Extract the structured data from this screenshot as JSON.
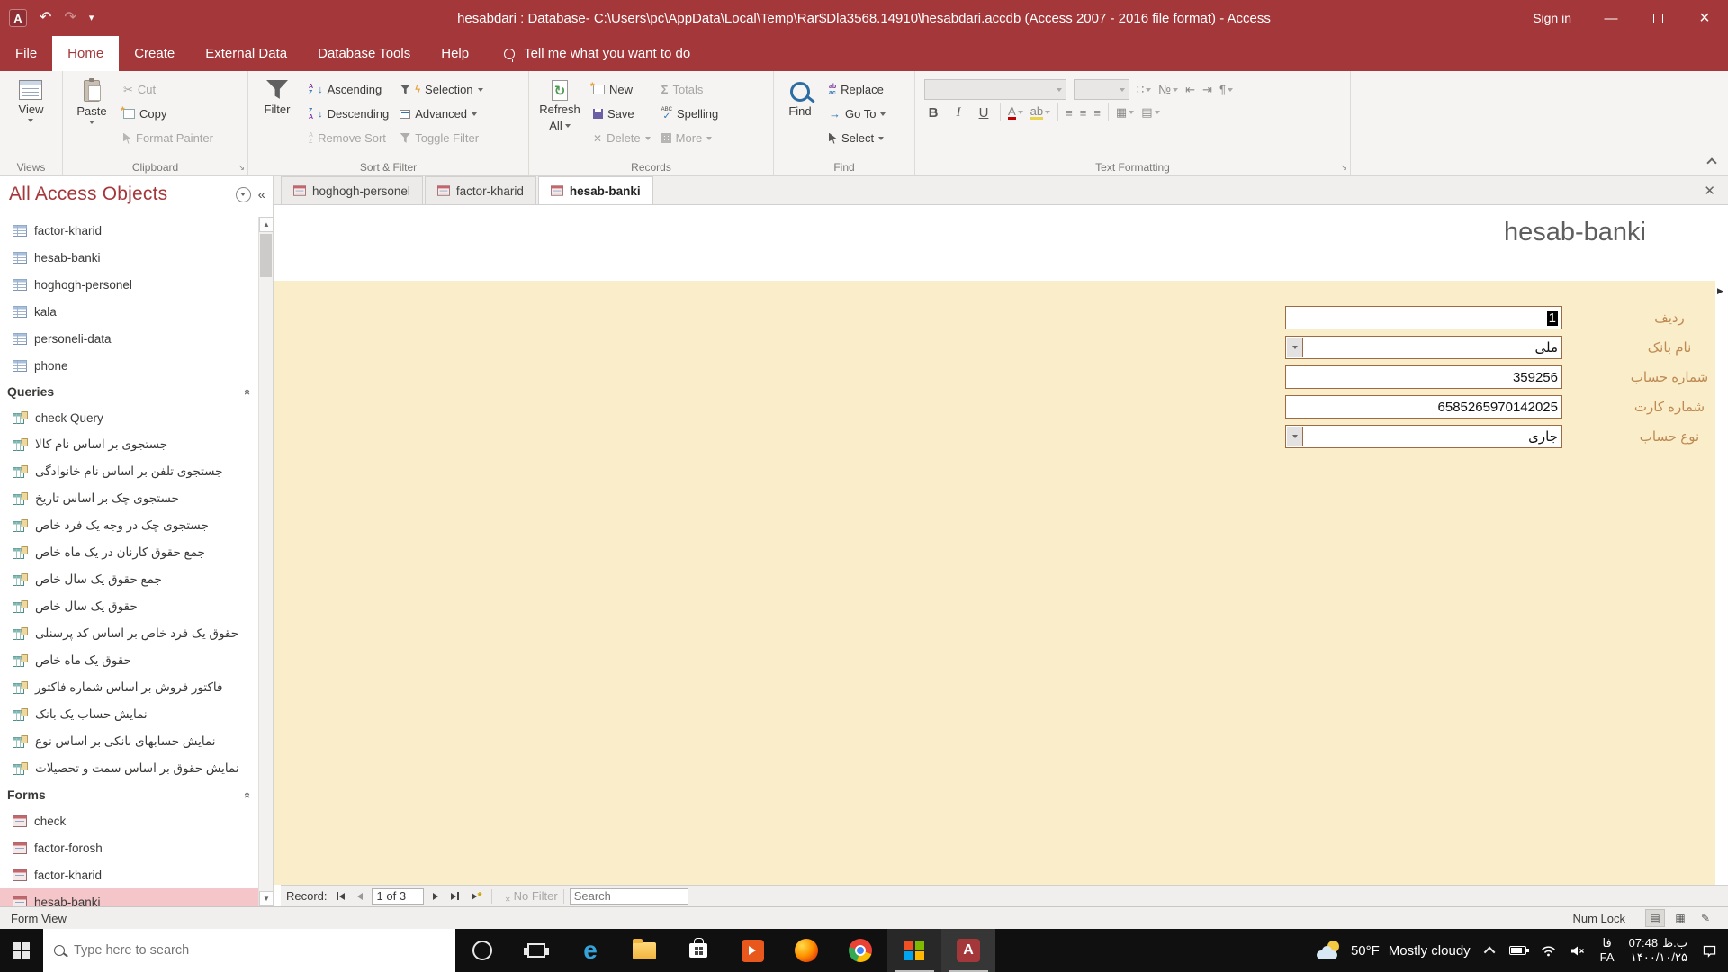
{
  "titlebar": {
    "app_initial": "A",
    "title": "hesabdari : Database- C:\\Users\\pc\\AppData\\Local\\Temp\\Rar$Dla3568.14910\\hesabdari.accdb (Access 2007 - 2016 file format)  -  Access",
    "sign_in": "Sign in"
  },
  "ribbon": {
    "tabs": [
      {
        "label": "File",
        "active": false
      },
      {
        "label": "Home",
        "active": true
      },
      {
        "label": "Create",
        "active": false
      },
      {
        "label": "External Data",
        "active": false
      },
      {
        "label": "Database Tools",
        "active": false
      },
      {
        "label": "Help",
        "active": false
      }
    ],
    "tell_me": "Tell me what you want to do",
    "views": {
      "group": "Views",
      "view": "View"
    },
    "clipboard": {
      "group": "Clipboard",
      "paste": "Paste",
      "cut": "Cut",
      "copy": "Copy",
      "format_painter": "Format Painter"
    },
    "sort_filter": {
      "group": "Sort & Filter",
      "filter": "Filter",
      "ascending": "Ascending",
      "descending": "Descending",
      "remove_sort": "Remove Sort",
      "selection": "Selection",
      "advanced": "Advanced",
      "toggle_filter": "Toggle Filter"
    },
    "records": {
      "group": "Records",
      "refresh_line1": "Refresh",
      "refresh_line2": "All",
      "new": "New",
      "save": "Save",
      "delete": "Delete",
      "totals": "Totals",
      "spelling": "Spelling",
      "more": "More"
    },
    "find": {
      "group": "Find",
      "find": "Find",
      "replace": "Replace",
      "goto": "Go To",
      "select": "Select"
    },
    "text_formatting": {
      "group": "Text Formatting",
      "bold": "B",
      "italic": "I",
      "underline": "U",
      "font_color": "A",
      "highlight": "ab"
    }
  },
  "nav": {
    "header": "All Access Objects",
    "tables": [
      {
        "label": "factor-kharid"
      },
      {
        "label": "hesab-banki"
      },
      {
        "label": "hoghogh-personel"
      },
      {
        "label": "kala"
      },
      {
        "label": "personeli-data"
      },
      {
        "label": "phone"
      }
    ],
    "queries_header": "Queries",
    "queries": [
      {
        "label": "check Query"
      },
      {
        "label": "جستجوی بر اساس نام کالا"
      },
      {
        "label": "جستجوی تلفن بر اساس نام خانوادگی"
      },
      {
        "label": "جستجوی چک بر اساس تاریخ"
      },
      {
        "label": "جستجوی چک در وجه یک فرد خاص"
      },
      {
        "label": "جمع حقوق کارنان در یک ماه خاص"
      },
      {
        "label": "جمع حقوق یک سال خاص"
      },
      {
        "label": "حقوق یک سال خاص"
      },
      {
        "label": "حقوق یک فرد خاص بر اساس کد پرسنلی"
      },
      {
        "label": "حقوق یک ماه خاص"
      },
      {
        "label": "فاکتور فروش بر اساس شماره فاکتور"
      },
      {
        "label": "نمایش حساب یک بانک"
      },
      {
        "label": "نمایش حسابهای بانکی بر اساس نوع"
      },
      {
        "label": "نمایش حقوق بر اساس سمت و تحصیلات"
      }
    ],
    "forms_header": "Forms",
    "forms": [
      {
        "label": "check",
        "selected": false
      },
      {
        "label": "factor-forosh",
        "selected": false
      },
      {
        "label": "factor-kharid",
        "selected": false
      },
      {
        "label": "hesab-banki",
        "selected": true
      }
    ]
  },
  "doc": {
    "tabs": [
      {
        "label": "hoghogh-personel",
        "active": false
      },
      {
        "label": "factor-kharid",
        "active": false
      },
      {
        "label": "hesab-banki",
        "active": true
      }
    ],
    "form_title": "hesab-banki",
    "fields": [
      {
        "label": "ردیف",
        "value": "1",
        "combo": false,
        "selected": true
      },
      {
        "label": "نام بانک",
        "value": "ملی",
        "combo": true,
        "selected": false
      },
      {
        "label": "شماره حساب",
        "value": "359256",
        "combo": false,
        "selected": false
      },
      {
        "label": "شماره کارت",
        "value": "6585265970142025",
        "combo": false,
        "selected": false
      },
      {
        "label": "نوع حساب",
        "value": "جاری",
        "combo": true,
        "selected": false
      }
    ],
    "record_nav": {
      "record_label": "Record:",
      "position": "1 of 3",
      "no_filter": "No Filter",
      "search_placeholder": "Search"
    }
  },
  "statusbar": {
    "left": "Form View",
    "num_lock": "Num Lock"
  },
  "taskbar": {
    "search_placeholder": "Type here to search",
    "weather_temp": "50°F",
    "weather_condition": "Mostly cloudy",
    "lang_top": "فا",
    "lang_bottom": "FA",
    "clock_time": "07:48",
    "clock_meridiem": "ب.ظ",
    "clock_date": "۱۴۰۰/۱۰/۲۵"
  },
  "colors": {
    "accent": "#A4373A",
    "form_background": "#FAEDC9",
    "selection_pink": "#F4C6CA",
    "field_label": "#BE8A54",
    "field_border": "#9C6B43"
  }
}
